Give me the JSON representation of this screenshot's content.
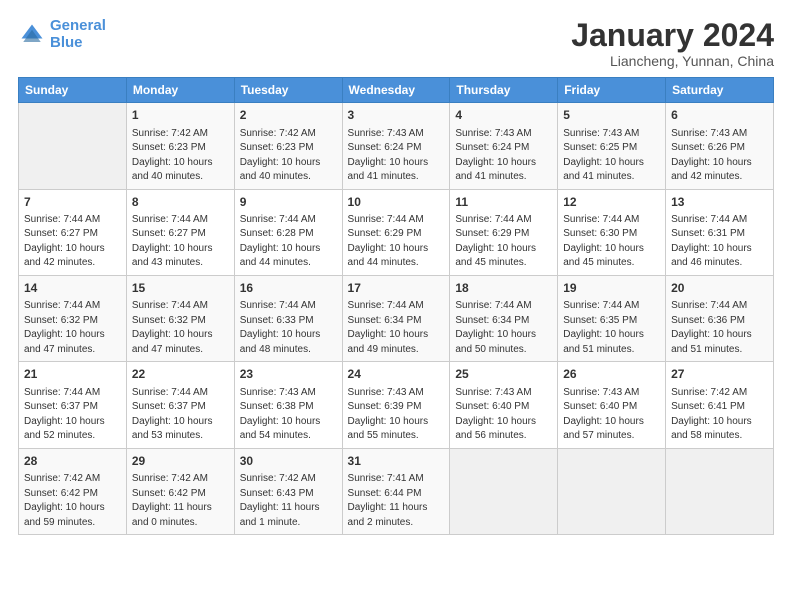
{
  "logo": {
    "line1": "General",
    "line2": "Blue"
  },
  "title": "January 2024",
  "location": "Liancheng, Yunnan, China",
  "weekdays": [
    "Sunday",
    "Monday",
    "Tuesday",
    "Wednesday",
    "Thursday",
    "Friday",
    "Saturday"
  ],
  "weeks": [
    [
      {
        "day": "",
        "content": ""
      },
      {
        "day": "1",
        "content": "Sunrise: 7:42 AM\nSunset: 6:23 PM\nDaylight: 10 hours\nand 40 minutes."
      },
      {
        "day": "2",
        "content": "Sunrise: 7:42 AM\nSunset: 6:23 PM\nDaylight: 10 hours\nand 40 minutes."
      },
      {
        "day": "3",
        "content": "Sunrise: 7:43 AM\nSunset: 6:24 PM\nDaylight: 10 hours\nand 41 minutes."
      },
      {
        "day": "4",
        "content": "Sunrise: 7:43 AM\nSunset: 6:24 PM\nDaylight: 10 hours\nand 41 minutes."
      },
      {
        "day": "5",
        "content": "Sunrise: 7:43 AM\nSunset: 6:25 PM\nDaylight: 10 hours\nand 41 minutes."
      },
      {
        "day": "6",
        "content": "Sunrise: 7:43 AM\nSunset: 6:26 PM\nDaylight: 10 hours\nand 42 minutes."
      }
    ],
    [
      {
        "day": "7",
        "content": "Sunrise: 7:44 AM\nSunset: 6:27 PM\nDaylight: 10 hours\nand 42 minutes."
      },
      {
        "day": "8",
        "content": "Sunrise: 7:44 AM\nSunset: 6:27 PM\nDaylight: 10 hours\nand 43 minutes."
      },
      {
        "day": "9",
        "content": "Sunrise: 7:44 AM\nSunset: 6:28 PM\nDaylight: 10 hours\nand 44 minutes."
      },
      {
        "day": "10",
        "content": "Sunrise: 7:44 AM\nSunset: 6:29 PM\nDaylight: 10 hours\nand 44 minutes."
      },
      {
        "day": "11",
        "content": "Sunrise: 7:44 AM\nSunset: 6:29 PM\nDaylight: 10 hours\nand 45 minutes."
      },
      {
        "day": "12",
        "content": "Sunrise: 7:44 AM\nSunset: 6:30 PM\nDaylight: 10 hours\nand 45 minutes."
      },
      {
        "day": "13",
        "content": "Sunrise: 7:44 AM\nSunset: 6:31 PM\nDaylight: 10 hours\nand 46 minutes."
      }
    ],
    [
      {
        "day": "14",
        "content": "Sunrise: 7:44 AM\nSunset: 6:32 PM\nDaylight: 10 hours\nand 47 minutes."
      },
      {
        "day": "15",
        "content": "Sunrise: 7:44 AM\nSunset: 6:32 PM\nDaylight: 10 hours\nand 47 minutes."
      },
      {
        "day": "16",
        "content": "Sunrise: 7:44 AM\nSunset: 6:33 PM\nDaylight: 10 hours\nand 48 minutes."
      },
      {
        "day": "17",
        "content": "Sunrise: 7:44 AM\nSunset: 6:34 PM\nDaylight: 10 hours\nand 49 minutes."
      },
      {
        "day": "18",
        "content": "Sunrise: 7:44 AM\nSunset: 6:34 PM\nDaylight: 10 hours\nand 50 minutes."
      },
      {
        "day": "19",
        "content": "Sunrise: 7:44 AM\nSunset: 6:35 PM\nDaylight: 10 hours\nand 51 minutes."
      },
      {
        "day": "20",
        "content": "Sunrise: 7:44 AM\nSunset: 6:36 PM\nDaylight: 10 hours\nand 51 minutes."
      }
    ],
    [
      {
        "day": "21",
        "content": "Sunrise: 7:44 AM\nSunset: 6:37 PM\nDaylight: 10 hours\nand 52 minutes."
      },
      {
        "day": "22",
        "content": "Sunrise: 7:44 AM\nSunset: 6:37 PM\nDaylight: 10 hours\nand 53 minutes."
      },
      {
        "day": "23",
        "content": "Sunrise: 7:43 AM\nSunset: 6:38 PM\nDaylight: 10 hours\nand 54 minutes."
      },
      {
        "day": "24",
        "content": "Sunrise: 7:43 AM\nSunset: 6:39 PM\nDaylight: 10 hours\nand 55 minutes."
      },
      {
        "day": "25",
        "content": "Sunrise: 7:43 AM\nSunset: 6:40 PM\nDaylight: 10 hours\nand 56 minutes."
      },
      {
        "day": "26",
        "content": "Sunrise: 7:43 AM\nSunset: 6:40 PM\nDaylight: 10 hours\nand 57 minutes."
      },
      {
        "day": "27",
        "content": "Sunrise: 7:42 AM\nSunset: 6:41 PM\nDaylight: 10 hours\nand 58 minutes."
      }
    ],
    [
      {
        "day": "28",
        "content": "Sunrise: 7:42 AM\nSunset: 6:42 PM\nDaylight: 10 hours\nand 59 minutes."
      },
      {
        "day": "29",
        "content": "Sunrise: 7:42 AM\nSunset: 6:42 PM\nDaylight: 11 hours\nand 0 minutes."
      },
      {
        "day": "30",
        "content": "Sunrise: 7:42 AM\nSunset: 6:43 PM\nDaylight: 11 hours\nand 1 minute."
      },
      {
        "day": "31",
        "content": "Sunrise: 7:41 AM\nSunset: 6:44 PM\nDaylight: 11 hours\nand 2 minutes."
      },
      {
        "day": "",
        "content": ""
      },
      {
        "day": "",
        "content": ""
      },
      {
        "day": "",
        "content": ""
      }
    ]
  ]
}
